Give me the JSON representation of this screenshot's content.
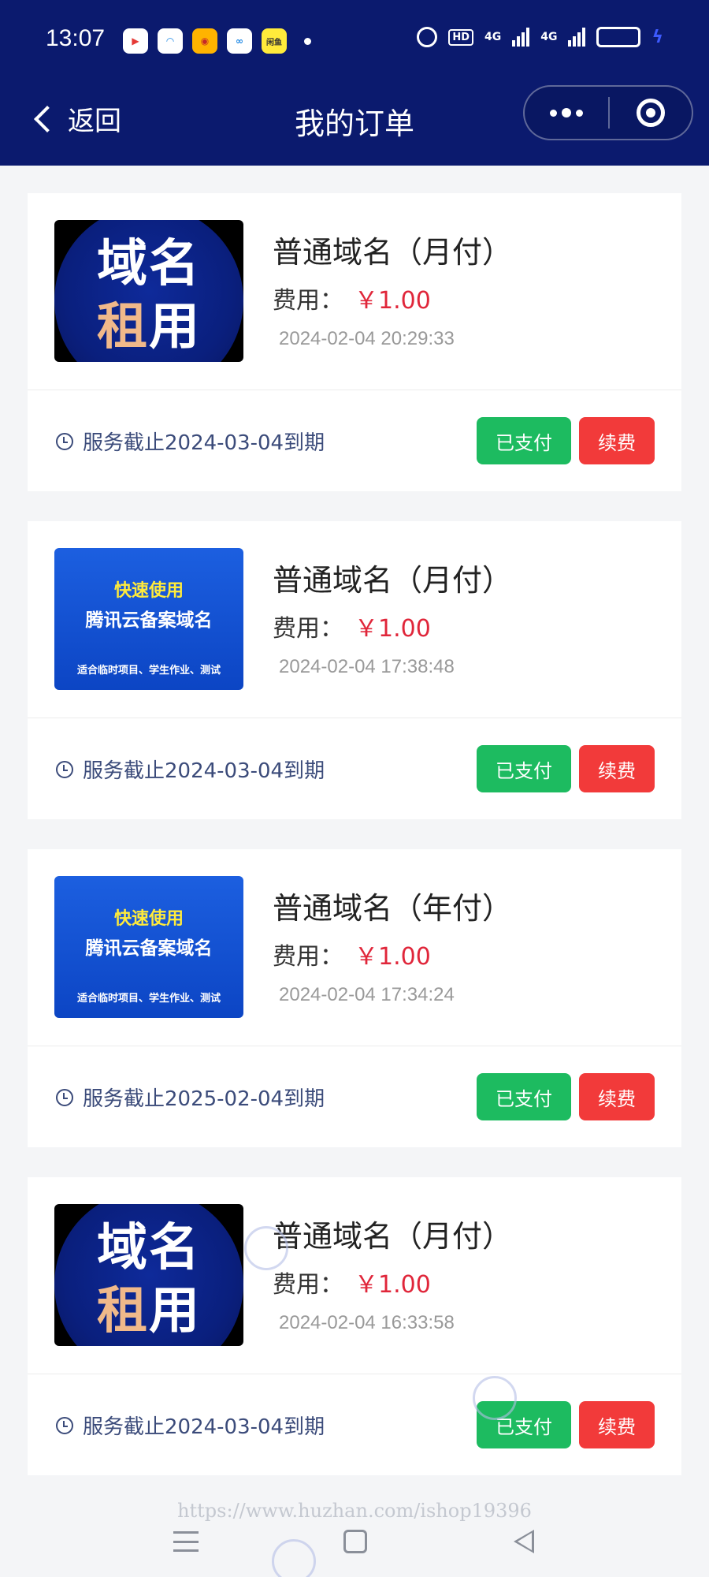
{
  "status_bar": {
    "time": "13:07",
    "apps": [
      {
        "icon": "video-app-icon",
        "glyph": "▶"
      },
      {
        "icon": "browser-app-icon",
        "glyph": "◠"
      },
      {
        "icon": "weibo-app-icon",
        "glyph": "◉"
      },
      {
        "icon": "cloud-app-icon",
        "glyph": "∞"
      },
      {
        "icon": "xianyu-app-icon",
        "glyph": "闲鱼"
      }
    ],
    "hd": "HD",
    "network_1": "4G",
    "network_2": "4G"
  },
  "header": {
    "back_label": "返回",
    "title": "我的订单"
  },
  "orders": [
    {
      "thumb_type": "domain-rental",
      "thumb_line1": "域名",
      "thumb_line2a": "租",
      "thumb_line2b": "用",
      "product": "普通域名（月付）",
      "fee_label": "费用：",
      "price": "￥1.00",
      "time": "2024-02-04 20:29:33",
      "expire": "服务截止2024-03-04到期",
      "paid_label": "已支付",
      "renew_label": "续费"
    },
    {
      "thumb_type": "tencent-cloud",
      "thumb_line1": "快速使用",
      "thumb_line2": "腾讯云备案域名",
      "thumb_line3": "适合临时项目、学生作业、测试",
      "product": "普通域名（月付）",
      "fee_label": "费用：",
      "price": "￥1.00",
      "time": "2024-02-04 17:38:48",
      "expire": "服务截止2024-03-04到期",
      "paid_label": "已支付",
      "renew_label": "续费"
    },
    {
      "thumb_type": "tencent-cloud",
      "thumb_line1": "快速使用",
      "thumb_line2": "腾讯云备案域名",
      "thumb_line3": "适合临时项目、学生作业、测试",
      "product": "普通域名（年付）",
      "fee_label": "费用：",
      "price": "￥1.00",
      "time": "2024-02-04 17:34:24",
      "expire": "服务截止2025-02-04到期",
      "paid_label": "已支付",
      "renew_label": "续费"
    },
    {
      "thumb_type": "domain-rental",
      "thumb_line1": "域名",
      "thumb_line2a": "租",
      "thumb_line2b": "用",
      "product": "普通域名（月付）",
      "fee_label": "费用：",
      "price": "￥1.00",
      "time": "2024-02-04 16:33:58",
      "expire": "服务截止2024-03-04到期",
      "paid_label": "已支付",
      "renew_label": "续费"
    }
  ],
  "watermark": "https://www.huzhan.com/ishop19396",
  "colors": {
    "header_bg": "#0b1a6e",
    "price": "#e0263a",
    "paid_button": "#1dbb60",
    "renew_button": "#f23a3a"
  }
}
